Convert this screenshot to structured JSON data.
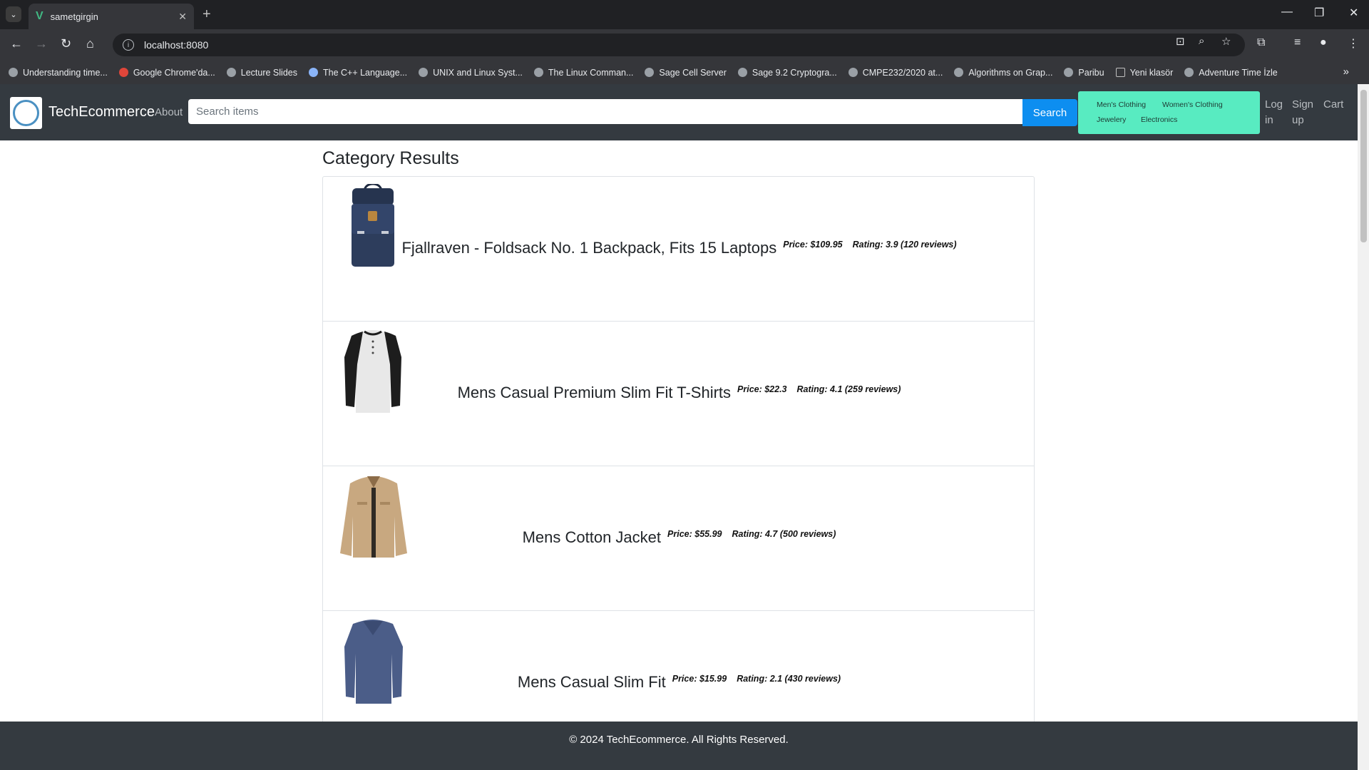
{
  "browser": {
    "tab_title": "sametgirgin",
    "url": "localhost:8080",
    "bookmarks": [
      "Understanding time...",
      "Google Chrome'da...",
      "Lecture Slides",
      "The C++ Language...",
      "UNIX and Linux Syst...",
      "The Linux Comman...",
      "Sage Cell Server",
      "Sage 9.2 Cryptogra...",
      "CMPE232/2020 at...",
      "Algorithms on Grap...",
      "Paribu",
      "Yeni klasör",
      "Adventure Time İzle"
    ]
  },
  "navbar": {
    "brand": "TechEcommerce",
    "about": "About",
    "search_placeholder": "Search items",
    "search_button": "Search",
    "categories": [
      "Men's Clothing",
      "Women's Clothing",
      "Jewelery",
      "Electronics"
    ],
    "login": "Log in",
    "signup": "Sign up",
    "cart": "Cart"
  },
  "main": {
    "heading": "Category Results",
    "products": [
      {
        "name": "Fjallraven - Foldsack No. 1 Backpack, Fits 15 Laptops",
        "price": "Price: $109.95",
        "rating": "Rating: 3.9 (120 reviews)",
        "image": "backpack"
      },
      {
        "name": "Mens Casual Premium Slim Fit T-Shirts",
        "price": "Price: $22.3",
        "rating": "Rating: 4.1 (259 reviews)",
        "image": "raglan-shirt"
      },
      {
        "name": "Mens Cotton Jacket",
        "price": "Price: $55.99",
        "rating": "Rating: 4.7 (500 reviews)",
        "image": "jacket"
      },
      {
        "name": "Mens Casual Slim Fit",
        "price": "Price: $15.99",
        "rating": "Rating: 2.1 (430 reviews)",
        "image": "long-sleeve-shirt"
      }
    ]
  },
  "footer": {
    "text": "© 2024 TechEcommerce. All Rights Reserved."
  }
}
